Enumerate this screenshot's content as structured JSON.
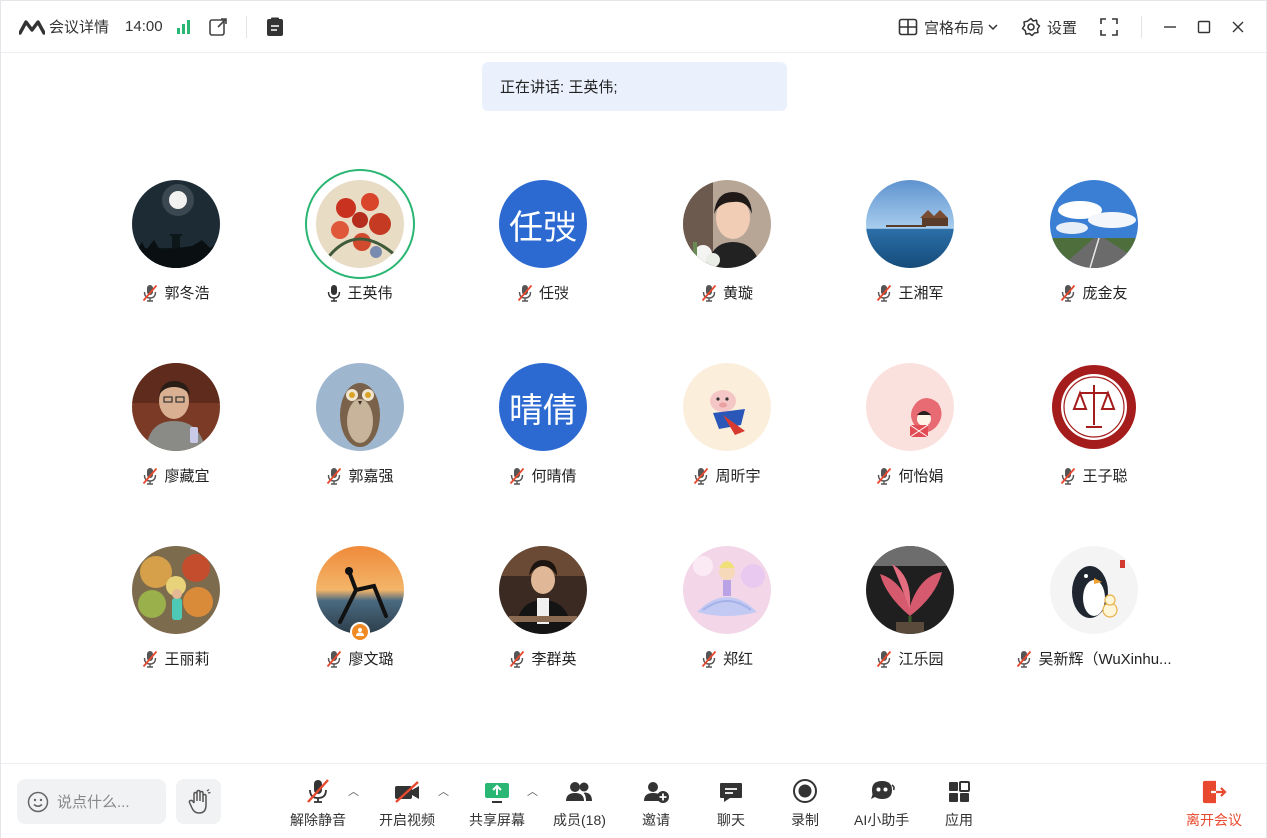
{
  "titlebar": {
    "meeting_details": "会议详情",
    "clock": "14:00",
    "layout_label": "宫格布局",
    "settings_label": "设置"
  },
  "speaking": {
    "text": "正在讲话: 王英伟;"
  },
  "participants": [
    {
      "name": "郭冬浩",
      "mic": "muted",
      "avatar": "moon-night"
    },
    {
      "name": "王英伟",
      "mic": "speaking",
      "avatar": "flowers"
    },
    {
      "name": "任弢",
      "mic": "muted",
      "avatar_text": "任弢"
    },
    {
      "name": "黄璇",
      "mic": "muted",
      "avatar": "woman-portrait"
    },
    {
      "name": "王湘军",
      "mic": "muted",
      "avatar": "seaside-pier"
    },
    {
      "name": "庞金友",
      "mic": "muted",
      "avatar": "blue-sky-road"
    },
    {
      "name": "廖藏宜",
      "mic": "muted",
      "avatar": "man-portrait"
    },
    {
      "name": "郭嘉强",
      "mic": "muted",
      "avatar": "owl"
    },
    {
      "name": "何晴倩",
      "mic": "muted",
      "avatar_text": "晴倩"
    },
    {
      "name": "周昕宇",
      "mic": "muted",
      "avatar": "cartoon-pig"
    },
    {
      "name": "何怡娟",
      "mic": "muted",
      "avatar": "cartoon-girl"
    },
    {
      "name": "王子聪",
      "mic": "muted",
      "avatar": "university-seal"
    },
    {
      "name": "王丽莉",
      "mic": "muted",
      "avatar": "food-child"
    },
    {
      "name": "廖文璐",
      "mic": "muted",
      "avatar": "sunset-yoga",
      "host_badge": true
    },
    {
      "name": "李群英",
      "mic": "muted",
      "avatar": "woman-office"
    },
    {
      "name": "郑红",
      "mic": "muted",
      "avatar": "ballerina"
    },
    {
      "name": "江乐园",
      "mic": "muted",
      "avatar": "plant"
    },
    {
      "name": "吴新辉（WuXinhu...",
      "mic": "muted",
      "avatar": "penguin"
    }
  ],
  "bottombar": {
    "chat_placeholder": "说点什么...",
    "tools": {
      "unmute": "解除静音",
      "video": "开启视频",
      "share": "共享屏幕",
      "members": "成员(18)",
      "invite": "邀请",
      "chat": "聊天",
      "record": "录制",
      "ai": "AI小助手",
      "apps": "应用"
    },
    "leave": "离开会议"
  },
  "colors": {
    "accent_green": "#2ab673",
    "avatar_blue": "#2c6ad2",
    "leave_red": "#e8492e",
    "banner_bg": "#eaf1fd"
  }
}
